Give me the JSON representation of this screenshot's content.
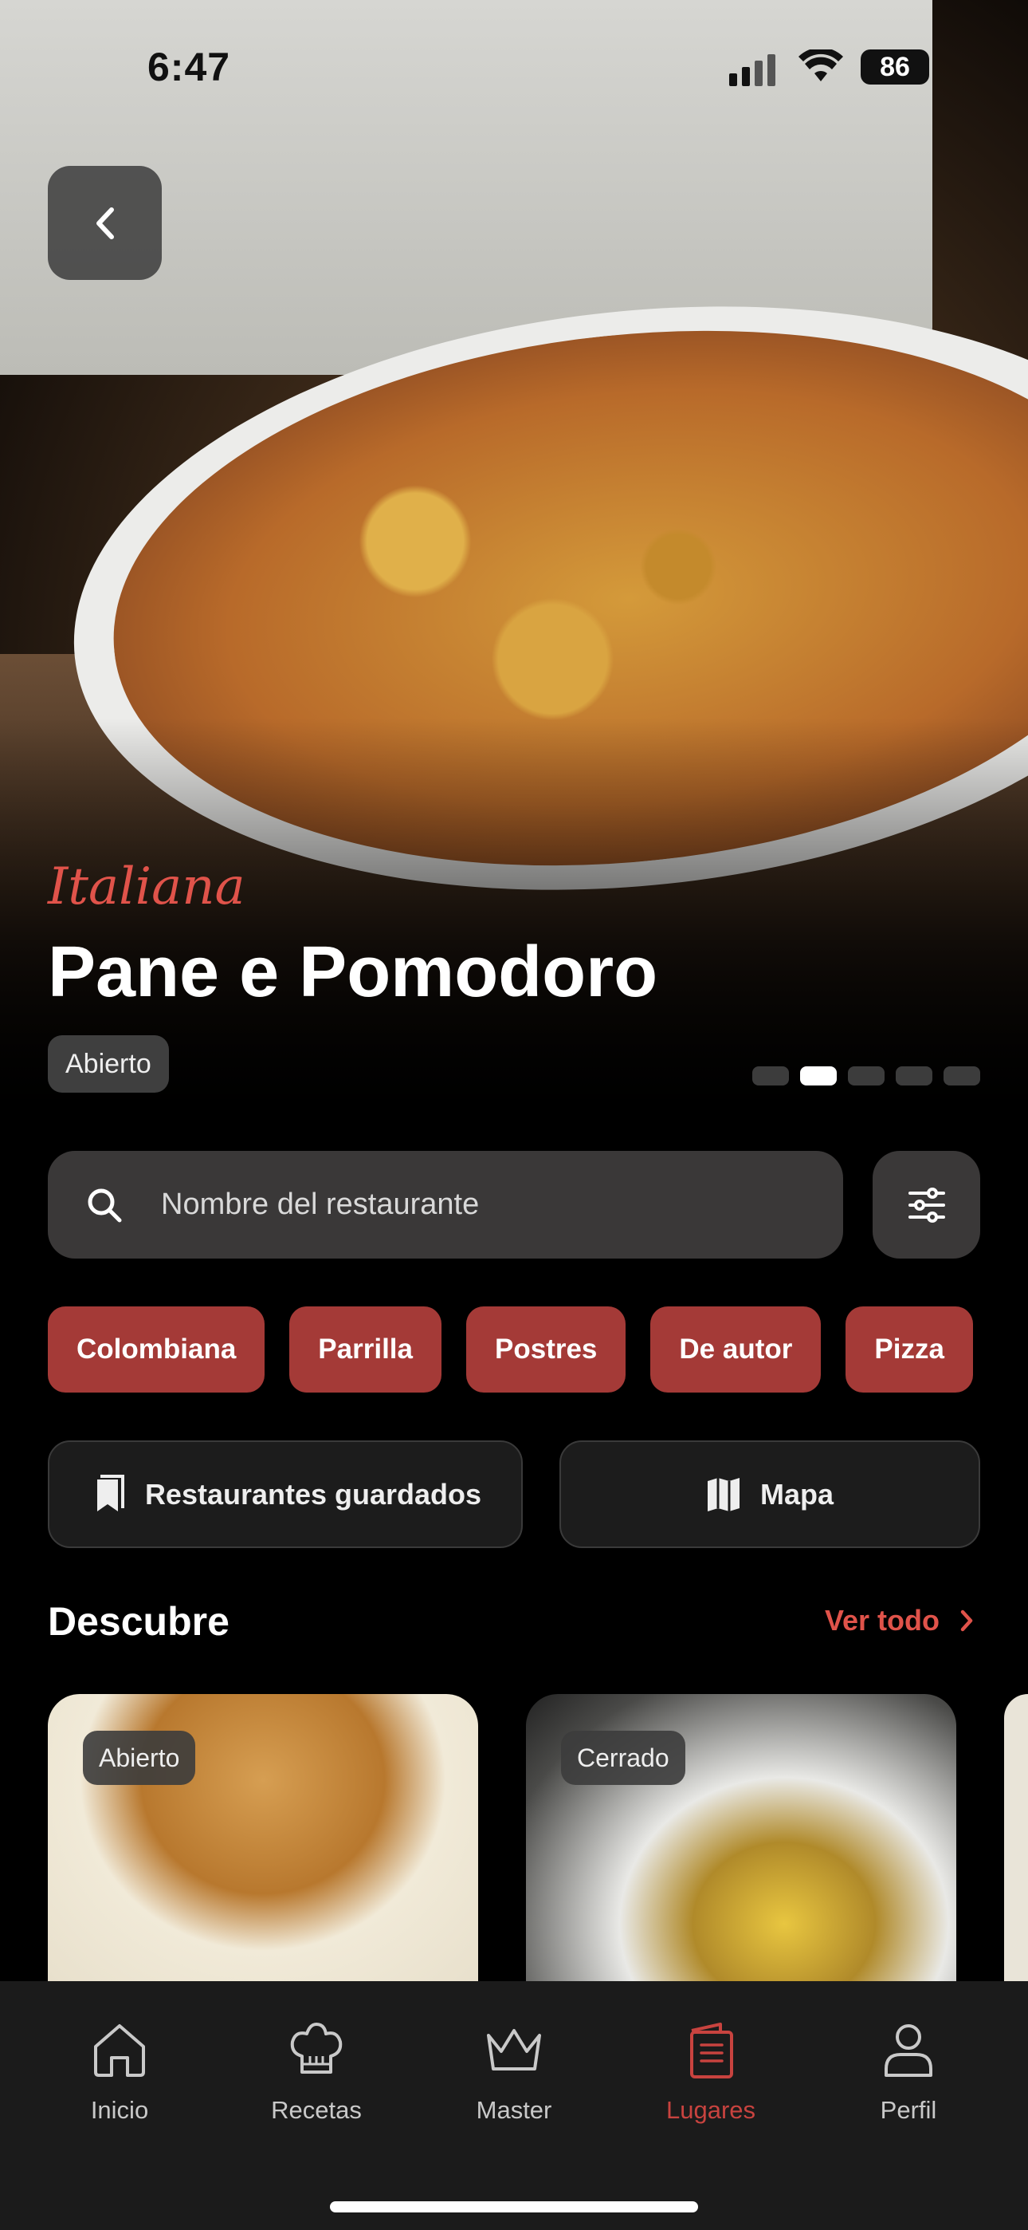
{
  "status_bar": {
    "time": "6:47",
    "battery": "86"
  },
  "hero": {
    "cuisine": "Italiana",
    "title": "Pane e Pomodoro",
    "status_badge": "Abierto",
    "carousel": {
      "total": 5,
      "active_index": 1
    }
  },
  "search": {
    "placeholder": "Nombre del restaurante"
  },
  "chips": [
    "Colombiana",
    "Parrilla",
    "Postres",
    "De autor",
    "Pizza"
  ],
  "quick_actions": {
    "saved_label": "Restaurantes guardados",
    "map_label": "Mapa"
  },
  "discover": {
    "title": "Descubre",
    "see_all": "Ver todo",
    "cards": [
      {
        "status": "Abierto"
      },
      {
        "status": "Cerrado"
      }
    ]
  },
  "tabs": [
    {
      "label": "Inicio",
      "icon": "home-icon"
    },
    {
      "label": "Recetas",
      "icon": "chef-hat-icon"
    },
    {
      "label": "Master",
      "icon": "crown-icon"
    },
    {
      "label": "Lugares",
      "icon": "menu-book-icon",
      "active": true
    },
    {
      "label": "Perfil",
      "icon": "user-icon"
    }
  ],
  "colors": {
    "accent": "#C8433F",
    "chip": "#A43A37",
    "surface": "#3A3838",
    "tabbar": "#1B1B1B"
  }
}
